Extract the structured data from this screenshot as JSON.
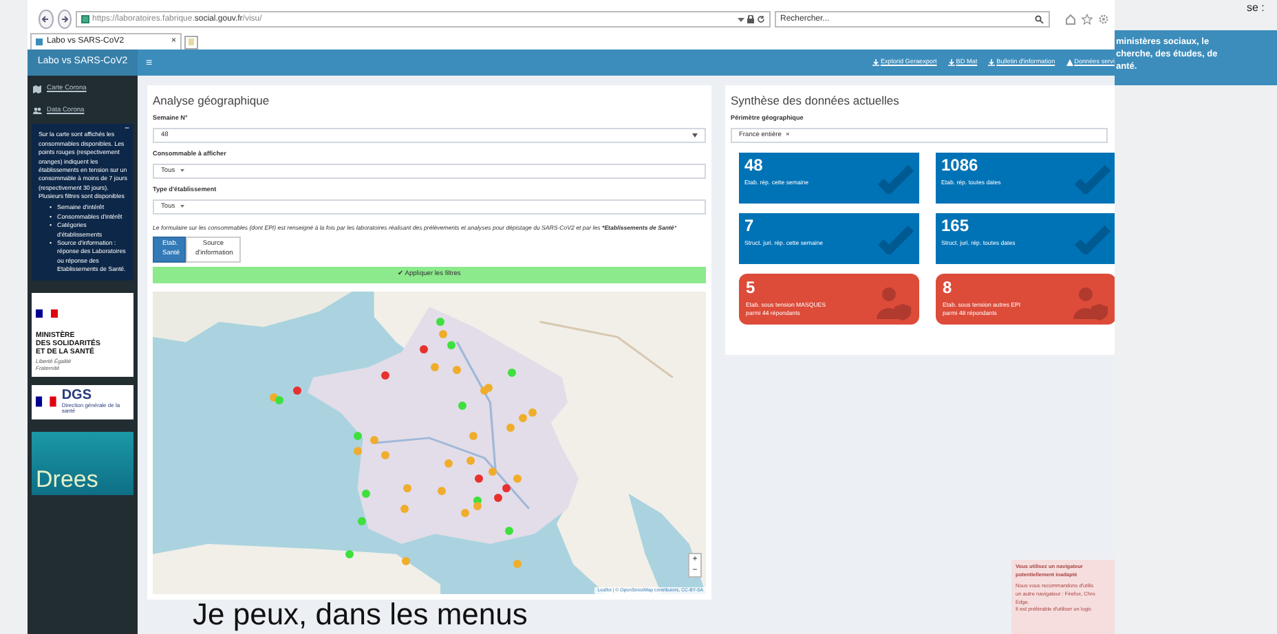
{
  "slide": {
    "top_text": "se :",
    "side_box": [
      "ministères sociaux, le",
      "cherche, des études, de",
      "anté."
    ],
    "caption": "Je peux, dans les menus"
  },
  "browser": {
    "url_prefix": "https://laboratoires.fabrique.",
    "url_domain": "social.gouv.fr",
    "url_path": "/visu/",
    "search_placeholder": "Rechercher...",
    "tab_title": "Labo vs SARS-CoV2",
    "tab_close": "×"
  },
  "navbar": {
    "brand": "Labo vs SARS-CoV2",
    "toggle": "≡",
    "links": [
      {
        "kind": "download",
        "label": "Explorid Geraexport"
      },
      {
        "kind": "download",
        "label": "BD Mat"
      },
      {
        "kind": "download",
        "label": "Bulletin d'information"
      },
      {
        "kind": "warning",
        "label": "Données servi"
      }
    ]
  },
  "sidebar": {
    "items": [
      {
        "kind": "map",
        "label": "Carte Corona"
      },
      {
        "kind": "users",
        "label": "Data Corona"
      }
    ],
    "info": {
      "collapse": "−",
      "bullet": "•",
      "text": "Sur la carte sont affichés les consommables disponibles. Les points rouges (respectivement oranges) indiquent les établissements en tension sur un consommable à moins de 7 jours (respectivement 30 jours).",
      "text2": "Plusieurs filtres sont disponibles",
      "list": [
        "Semaine d'intérêt",
        "Consommables d'intérêt",
        "Catégories d'établissements",
        "Source d'information : réponse des Laboratoires ou réponse des Etablissements de Santé."
      ]
    },
    "logos": {
      "ministry": [
        "MINISTÈRE",
        "DES SOLIDARITÉS",
        "ET DE LA SANTÉ"
      ],
      "motto": "Liberté Égalité Fraternité",
      "dgs": "DGS",
      "dgs_sub": "Direction générale de la santé",
      "drees": "Drees"
    }
  },
  "analysis": {
    "title": "Analyse géographique",
    "fields": [
      {
        "label": "Semaine N°",
        "kind": "select",
        "value": "48"
      },
      {
        "label": "Consommable à afficher",
        "kind": "tag",
        "value": "Tous"
      },
      {
        "label": "Type d'établissement",
        "kind": "tag",
        "value": "Tous"
      }
    ],
    "note": "*Le formulaire sur les consommables (dont EPI) est renseigné à la fois par les laboratoires réalisant des prélèvements et analyses pour dépistage du SARS-CoV2 et par les* ***Etablissements de Santé***",
    "toggle": [
      {
        "label": "Etab. Santé",
        "selected": true
      },
      {
        "label": "Source d'information",
        "selected": false
      }
    ],
    "apply": "✔ Appliquer les filtres",
    "map": {
      "zoom_in": "+",
      "zoom_out": "−",
      "attribution": "Leaflet | © OpenStreetMap contributors, CC-BY-SA",
      "markers": [
        {
          "color": "#3ee03e"
        },
        {
          "color": "#f0ad2c"
        },
        {
          "color": "#3ee03e"
        },
        {
          "color": "#e8312f"
        },
        {
          "color": "#f0ad2c"
        },
        {
          "color": "#f0ad2c"
        },
        {
          "color": "#e8312f"
        },
        {
          "color": "#3ee03e"
        },
        {
          "color": "#f0ad2c"
        },
        {
          "color": "#f0ad2c"
        },
        {
          "color": "#e8312f"
        },
        {
          "color": "#f0ad2c"
        },
        {
          "color": "#3ee03e"
        },
        {
          "color": "#3ee03e"
        },
        {
          "color": "#f0ad2c"
        },
        {
          "color": "#f0ad2c"
        },
        {
          "color": "#f0ad2c"
        },
        {
          "color": "#3ee03e"
        },
        {
          "color": "#f0ad2c"
        },
        {
          "color": "#f0ad2c"
        },
        {
          "color": "#f0ad2c"
        },
        {
          "color": "#f0ad2c"
        },
        {
          "color": "#f0ad2c"
        },
        {
          "color": "#f0ad2c"
        },
        {
          "color": "#f0ad2c"
        },
        {
          "color": "#f0ad2c"
        },
        {
          "color": "#e8312f"
        },
        {
          "color": "#e8312f"
        },
        {
          "color": "#3ee03e"
        },
        {
          "color": "#f0ad2c"
        },
        {
          "color": "#f0ad2c"
        },
        {
          "color": "#3ee03e"
        },
        {
          "color": "#e8312f"
        },
        {
          "color": "#f0ad2c"
        },
        {
          "color": "#f0ad2c"
        },
        {
          "color": "#f0ad2c"
        },
        {
          "color": "#3ee03e"
        },
        {
          "color": "#3ee03e"
        },
        {
          "color": "#3ee03e"
        },
        {
          "color": "#f0ad2c"
        },
        {
          "color": "#f0ad2c"
        }
      ]
    }
  },
  "summary": {
    "title": "Synthèse des données actuelles",
    "perimeter_label": "Périmètre géographique",
    "perimeter_value": "France entière",
    "perimeter_remove": "×",
    "tiles": [
      {
        "kind": "ok",
        "value": "48",
        "lines": [
          "Etab. rép. cette semaine"
        ]
      },
      {
        "kind": "ok",
        "value": "1086",
        "lines": [
          "Etab. rép. toutes dates"
        ]
      },
      {
        "kind": "ok",
        "value": "7",
        "lines": [
          "Struct. juri. rép. cette semaine"
        ]
      },
      {
        "kind": "ok",
        "value": "165",
        "lines": [
          "Struct. juri. rép. toutes dates"
        ]
      },
      {
        "kind": "alert",
        "value": "5",
        "lines": [
          "Etab. sous tension MASQUES",
          "parmi 44 répondants"
        ]
      },
      {
        "kind": "alert",
        "value": "8",
        "lines": [
          "Etab. sous tension autres EPI",
          "parmi 48 répondants"
        ]
      }
    ]
  },
  "browser_warning": {
    "title": "Vous utilisez un navigateur potentiellement inadapté",
    "lines": [
      "Nous vous recommandons d'utilis",
      "un autre navigateur : Firefox, Chro",
      "Edge.",
      "Il est préférable d'utiliser un logic"
    ]
  }
}
